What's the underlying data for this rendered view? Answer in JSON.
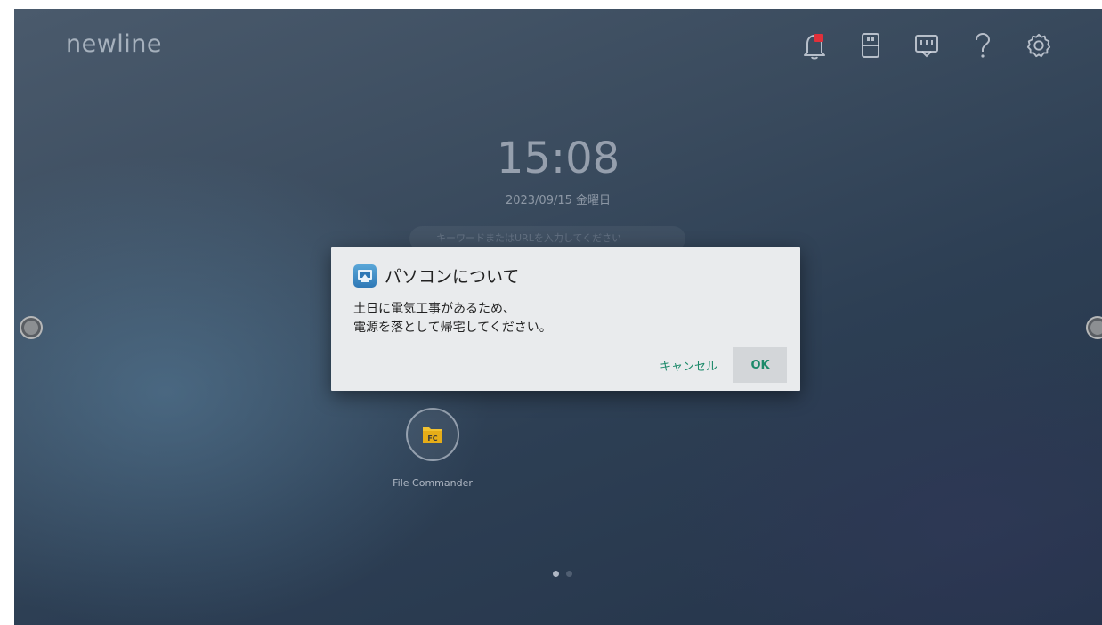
{
  "brand": "newline",
  "clock": {
    "time": "15:08",
    "date": "2023/09/15 金曜日"
  },
  "search": {
    "placeholder": "キーワードまたはURLを入力してください"
  },
  "top_bar": {
    "icons": [
      "notification-bell-icon",
      "usb-storage-icon",
      "network-icon",
      "help-icon",
      "settings-icon"
    ],
    "notification_dot_color": "#e0303a"
  },
  "dialog": {
    "title": "パソコンについて",
    "message_line1": "土日に電気工事があるため、",
    "message_line2": "電源を落として帰宅してください。",
    "cancel_label": "キャンセル",
    "ok_label": "OK",
    "accent_color": "#1c8a6a"
  },
  "apps": [
    {
      "label": "File Commander",
      "icon": "file-commander-icon",
      "icon_text": "FC"
    }
  ],
  "pager": {
    "pages": 2,
    "current": 1
  }
}
